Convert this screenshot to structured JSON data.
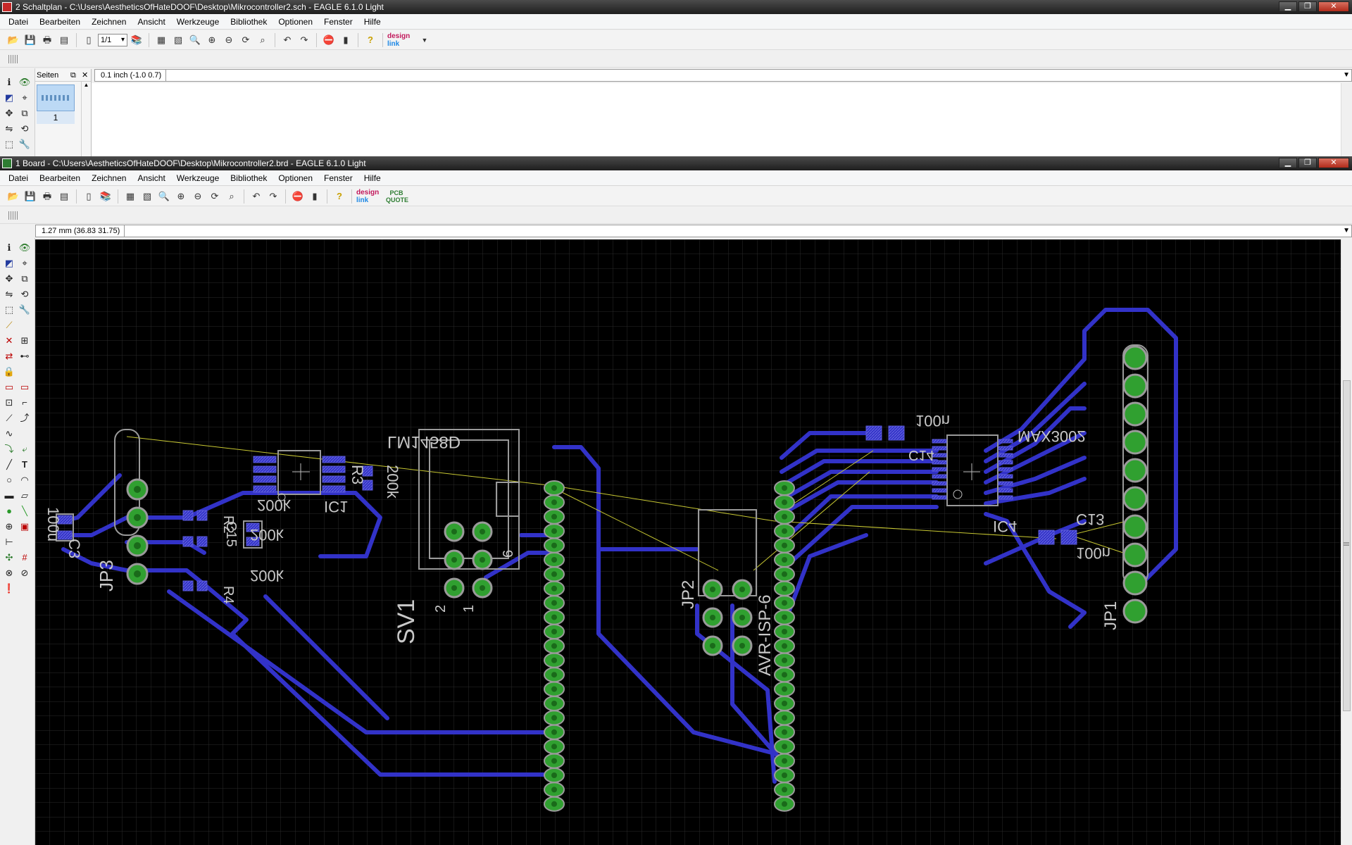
{
  "schematic_window": {
    "title": "2 Schaltplan - C:\\Users\\AestheticsOfHateDOOF\\Desktop\\Mikrocontroller2.sch - EAGLE 6.1.0 Light",
    "menu": [
      "Datei",
      "Bearbeiten",
      "Zeichnen",
      "Ansicht",
      "Werkzeuge",
      "Bibliothek",
      "Optionen",
      "Fenster",
      "Hilfe"
    ],
    "sheet_select": "1/1",
    "grid_readout": "0.1 inch (-1.0 0.7)",
    "pages_panel": {
      "title": "Seiten",
      "page_label": "1"
    },
    "logo": {
      "line1": "design",
      "line2": "link"
    }
  },
  "board_window": {
    "title": "1 Board - C:\\Users\\AestheticsOfHateDOOF\\Desktop\\Mikrocontroller2.brd - EAGLE 6.1.0 Light",
    "menu": [
      "Datei",
      "Bearbeiten",
      "Zeichnen",
      "Ansicht",
      "Werkzeuge",
      "Bibliothek",
      "Optionen",
      "Fenster",
      "Hilfe"
    ],
    "grid_readout": "1.27 mm (36.83 31.75)",
    "logo": {
      "line1": "design",
      "line2": "link",
      "pcb_line1": "PCB",
      "pcb_line2": "QUOTE"
    },
    "labels": {
      "c3": "C3",
      "c3_val": "100u",
      "jp3": "JP3",
      "r_vals": [
        "200k",
        "200k",
        "200k"
      ],
      "r2": "R2",
      "r4": "R4",
      "ic1_val": "LM1458D",
      "ic1": "IC1",
      "r3": "R3",
      "r3_val": "200k",
      "c15": "C15",
      "sv1": "SV1",
      "sv1_pin2": "2",
      "sv1_pin1": "1",
      "sv1_pin6": "6",
      "jp2": "JP2",
      "avr": "AVR-ISP-6",
      "c14_val": "100n",
      "c14": "C14",
      "ic4_val": "MAX3002",
      "ic4": "IC4",
      "c13": "C13",
      "c13_val": "100n",
      "jp1": "JP1"
    }
  },
  "colors": {
    "board_bg": "#000000",
    "grid": "#2a2a2a",
    "bottom_trace": "#3232c8",
    "pad_green": "#30a030",
    "pad_outline": "#9a9a9a",
    "airwire": "#c8c832",
    "silkscreen": "#bdbdbd"
  }
}
